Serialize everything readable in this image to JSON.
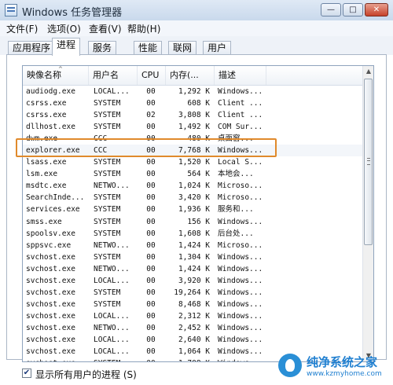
{
  "window": {
    "title": "Windows 任务管理器",
    "buttons": {
      "minimize": "—",
      "maximize": "□",
      "close": "✕"
    }
  },
  "menu": [
    "文件(F)",
    "选项(O)",
    "查看(V)",
    "帮助(H)"
  ],
  "tabs": [
    "应用程序",
    "进程",
    "服务",
    "性能",
    "联网",
    "用户"
  ],
  "active_tab": "进程",
  "columns": [
    "映像名称",
    "用户名",
    "CPU",
    "内存(...",
    "描述"
  ],
  "rows": [
    {
      "name": "audiodg.exe",
      "user": "LOCAL...",
      "cpu": "00",
      "mem": "1,292 K",
      "desc": "Windows..."
    },
    {
      "name": "csrss.exe",
      "user": "SYSTEM",
      "cpu": "00",
      "mem": "608 K",
      "desc": "Client ..."
    },
    {
      "name": "csrss.exe",
      "user": "SYSTEM",
      "cpu": "02",
      "mem": "3,808 K",
      "desc": "Client ..."
    },
    {
      "name": "dllhost.exe",
      "user": "SYSTEM",
      "cpu": "00",
      "mem": "1,492 K",
      "desc": "COM Sur..."
    },
    {
      "name": "dwm.exe",
      "user": "CCC",
      "cpu": "00",
      "mem": "480 K",
      "desc": "桌面窗..."
    },
    {
      "name": "explorer.exe",
      "user": "CCC",
      "cpu": "00",
      "mem": "7,768 K",
      "desc": "Windows..."
    },
    {
      "name": "lsass.exe",
      "user": "SYSTEM",
      "cpu": "00",
      "mem": "1,520 K",
      "desc": "Local S..."
    },
    {
      "name": "lsm.exe",
      "user": "SYSTEM",
      "cpu": "00",
      "mem": "564 K",
      "desc": "本地会..."
    },
    {
      "name": "msdtc.exe",
      "user": "NETWO...",
      "cpu": "00",
      "mem": "1,024 K",
      "desc": "Microso..."
    },
    {
      "name": "SearchInde...",
      "user": "SYSTEM",
      "cpu": "00",
      "mem": "3,420 K",
      "desc": "Microso..."
    },
    {
      "name": "services.exe",
      "user": "SYSTEM",
      "cpu": "00",
      "mem": "1,936 K",
      "desc": "服务和..."
    },
    {
      "name": "smss.exe",
      "user": "SYSTEM",
      "cpu": "00",
      "mem": "156 K",
      "desc": "Windows..."
    },
    {
      "name": "spoolsv.exe",
      "user": "SYSTEM",
      "cpu": "00",
      "mem": "1,608 K",
      "desc": "后台处..."
    },
    {
      "name": "sppsvc.exe",
      "user": "NETWO...",
      "cpu": "00",
      "mem": "1,424 K",
      "desc": "Microso..."
    },
    {
      "name": "svchost.exe",
      "user": "SYSTEM",
      "cpu": "00",
      "mem": "1,304 K",
      "desc": "Windows..."
    },
    {
      "name": "svchost.exe",
      "user": "NETWO...",
      "cpu": "00",
      "mem": "1,424 K",
      "desc": "Windows..."
    },
    {
      "name": "svchost.exe",
      "user": "LOCAL...",
      "cpu": "00",
      "mem": "3,920 K",
      "desc": "Windows..."
    },
    {
      "name": "svchost.exe",
      "user": "SYSTEM",
      "cpu": "00",
      "mem": "19,264 K",
      "desc": "Windows..."
    },
    {
      "name": "svchost.exe",
      "user": "SYSTEM",
      "cpu": "00",
      "mem": "8,468 K",
      "desc": "Windows..."
    },
    {
      "name": "svchost.exe",
      "user": "LOCAL...",
      "cpu": "00",
      "mem": "2,312 K",
      "desc": "Windows..."
    },
    {
      "name": "svchost.exe",
      "user": "NETWO...",
      "cpu": "00",
      "mem": "2,452 K",
      "desc": "Windows..."
    },
    {
      "name": "svchost.exe",
      "user": "LOCAL...",
      "cpu": "00",
      "mem": "2,640 K",
      "desc": "Windows..."
    },
    {
      "name": "svchost.exe",
      "user": "LOCAL...",
      "cpu": "00",
      "mem": "1,064 K",
      "desc": "Windows..."
    },
    {
      "name": "svchost.exe",
      "user": "SYSTEM",
      "cpu": "00",
      "mem": "1,708 K",
      "desc": "Windows..."
    }
  ],
  "selected_row": "explorer.exe",
  "highlight_color": "#e08a2c",
  "footer": {
    "show_all_users_checked": true,
    "show_all_users_label": "显示所有用户的进程 (S)"
  },
  "watermark": {
    "title": "纯净系统之家",
    "url": "www.kzmyhome.com"
  },
  "colors": {
    "titlebar": "#c9d9ec",
    "close_button": "#c6422a",
    "watermark": "#1f7fd0"
  }
}
